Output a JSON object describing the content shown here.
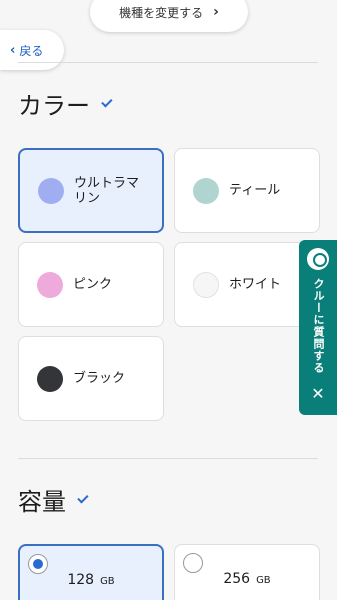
{
  "header": {
    "change_model_label": "機種を変更する",
    "back_label": "戻る"
  },
  "color_section": {
    "title": "カラー",
    "options": [
      {
        "label": "ウルトラマリン",
        "line1": "ウルトラマ",
        "line2": "リン",
        "swatch": "#a0aef1",
        "selected": true
      },
      {
        "label": "ティール",
        "swatch": "#b0d4cf",
        "selected": false
      },
      {
        "label": "ピンク",
        "swatch": "#eeaadb",
        "selected": false
      },
      {
        "label": "ホワイト",
        "swatch": "#f6f6f6",
        "selected": false
      },
      {
        "label": "ブラック",
        "swatch": "#343538",
        "selected": false
      }
    ]
  },
  "storage_section": {
    "title": "容量",
    "options": [
      {
        "capacity": "128",
        "unit": "GB",
        "selected": true
      },
      {
        "capacity": "256",
        "unit": "GB",
        "selected": false
      }
    ]
  },
  "crew_tab": {
    "label": "クルーに質問する",
    "close": "✕"
  },
  "colors": {
    "accent": "#2a6bd1",
    "selected_bg": "#e8f0fe",
    "crew_bg": "#0a7f7a"
  }
}
